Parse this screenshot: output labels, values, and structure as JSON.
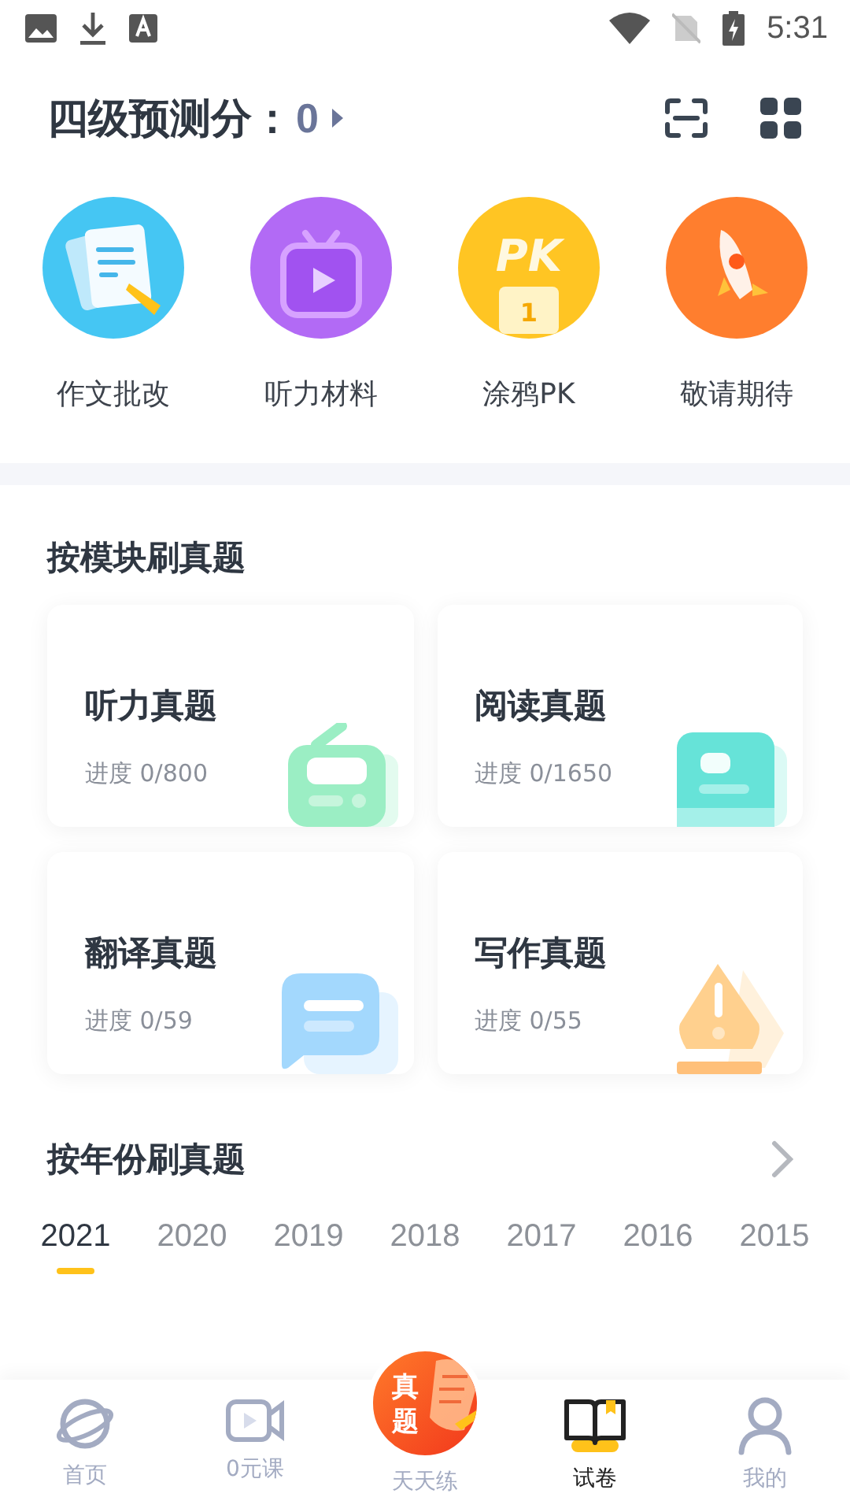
{
  "status_bar": {
    "time": "5:31"
  },
  "header": {
    "title": "四级预测分：",
    "score": "0"
  },
  "shortcuts": [
    {
      "kind": "essay",
      "label": "作文批改"
    },
    {
      "kind": "tv",
      "label": "听力材料"
    },
    {
      "kind": "pk",
      "label": "涂鸦PK",
      "badge": "PK",
      "rank": "1"
    },
    {
      "kind": "rocket",
      "label": "敬请期待"
    }
  ],
  "modules": {
    "title": "按模块刷真题",
    "cards": [
      {
        "kind": "radio",
        "title": "听力真题",
        "progress": "进度 0/800"
      },
      {
        "kind": "book",
        "title": "阅读真题",
        "progress": "进度 0/1650"
      },
      {
        "kind": "chat",
        "title": "翻译真题",
        "progress": "进度 0/59"
      },
      {
        "kind": "pen",
        "title": "写作真题",
        "progress": "进度 0/55"
      }
    ]
  },
  "years": {
    "title": "按年份刷真题",
    "tabs": [
      {
        "label": "2021",
        "selected": true
      },
      {
        "label": "2020",
        "selected": false
      },
      {
        "label": "2019",
        "selected": false
      },
      {
        "label": "2018",
        "selected": false
      },
      {
        "label": "2017",
        "selected": false
      },
      {
        "label": "2016",
        "selected": false
      },
      {
        "label": "2015",
        "selected": false
      }
    ]
  },
  "bottom_nav": [
    {
      "kind": "planet",
      "label": "首页",
      "selected": false
    },
    {
      "kind": "video",
      "label": "0元课",
      "selected": false
    },
    {
      "kind": "featured",
      "label": "天天练",
      "badge": [
        "真",
        "题"
      ],
      "selected": false
    },
    {
      "kind": "book",
      "label": "试卷",
      "selected": true
    },
    {
      "kind": "person",
      "label": "我的",
      "selected": false
    }
  ]
}
